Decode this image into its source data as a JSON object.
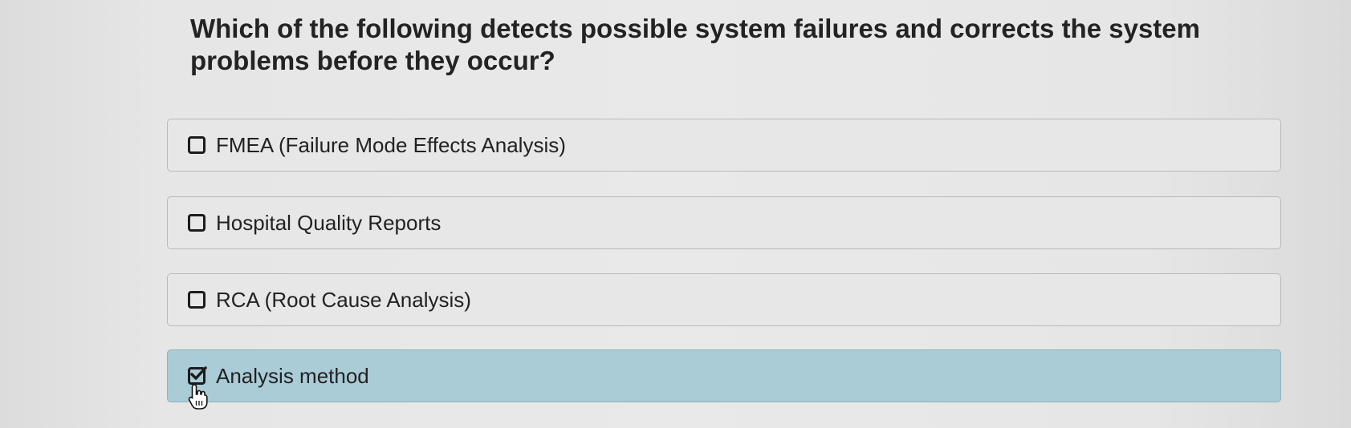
{
  "question": {
    "text": "Which of the following detects possible system failures and corrects the system problems before they occur?"
  },
  "options": [
    {
      "label": "FMEA (Failure Mode Effects Analysis)",
      "checked": false
    },
    {
      "label": "Hospital Quality Reports",
      "checked": false
    },
    {
      "label": "RCA (Root Cause Analysis)",
      "checked": false
    },
    {
      "label": "Analysis method",
      "checked": true
    }
  ],
  "colors": {
    "selected_background": "#a9ccd7",
    "option_background": "#e7e7e7",
    "option_border": "#b9b9b9"
  },
  "icons": {
    "checkbox": "checkbox-icon",
    "checkmark": "checkmark-icon",
    "cursor": "hand-pointer-icon"
  }
}
